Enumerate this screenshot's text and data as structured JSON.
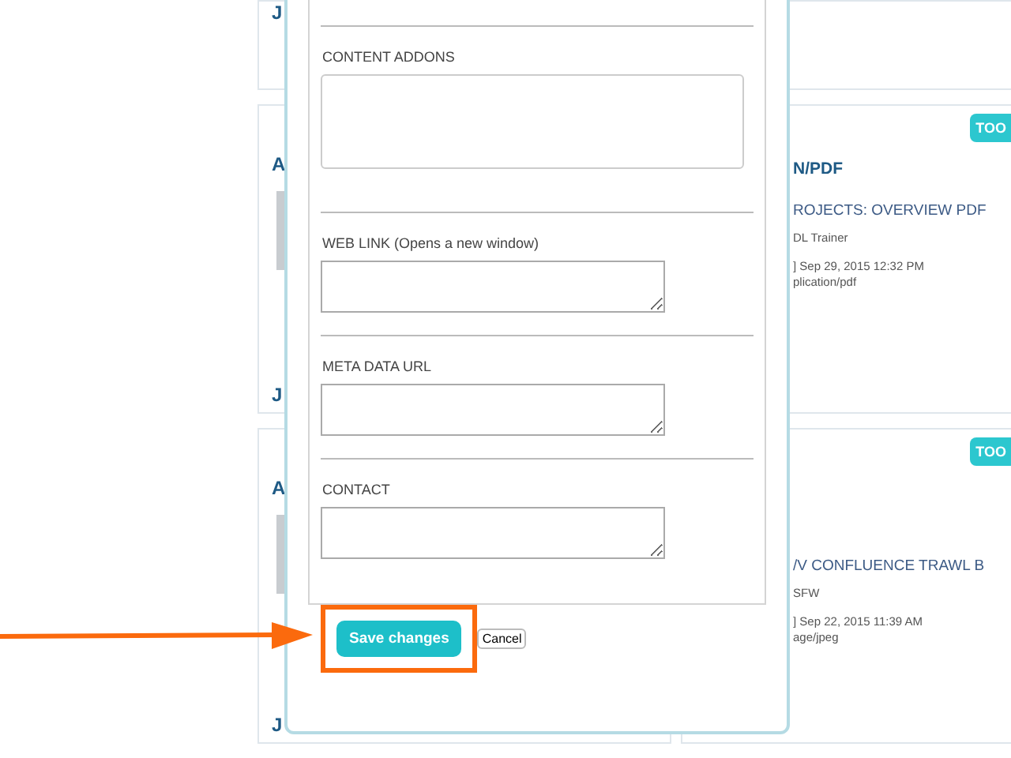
{
  "left_cards": [
    {
      "kind": "text",
      "footer": "J"
    },
    {
      "kind": "media",
      "title": "A",
      "footer": "J"
    },
    {
      "kind": "media",
      "title": "A",
      "footer": "J"
    }
  ],
  "right_cards": [
    {
      "kind": "empty"
    },
    {
      "kind": "item",
      "badge": "TOO",
      "heading": "N/PDF",
      "title": "ROJECTS: OVERVIEW PDF",
      "author": "DL Trainer",
      "date": "] Sep 29, 2015 12:32 PM",
      "type": "plication/pdf"
    },
    {
      "kind": "item",
      "badge": "TOO",
      "title": "/V CONFLUENCE TRAWL B",
      "author": "SFW",
      "date": "] Sep 22, 2015 11:39 AM",
      "type": "age/jpeg"
    }
  ],
  "modal": {
    "fields": [
      {
        "label": "CONTENT ADDONS",
        "kind": "large"
      },
      {
        "label": "WEB LINK (Opens a new window)",
        "kind": "small"
      },
      {
        "label": "META DATA URL",
        "kind": "small"
      },
      {
        "label": "CONTACT",
        "kind": "small"
      }
    ],
    "save_button": "Save changes",
    "cancel_button": "Cancel"
  }
}
